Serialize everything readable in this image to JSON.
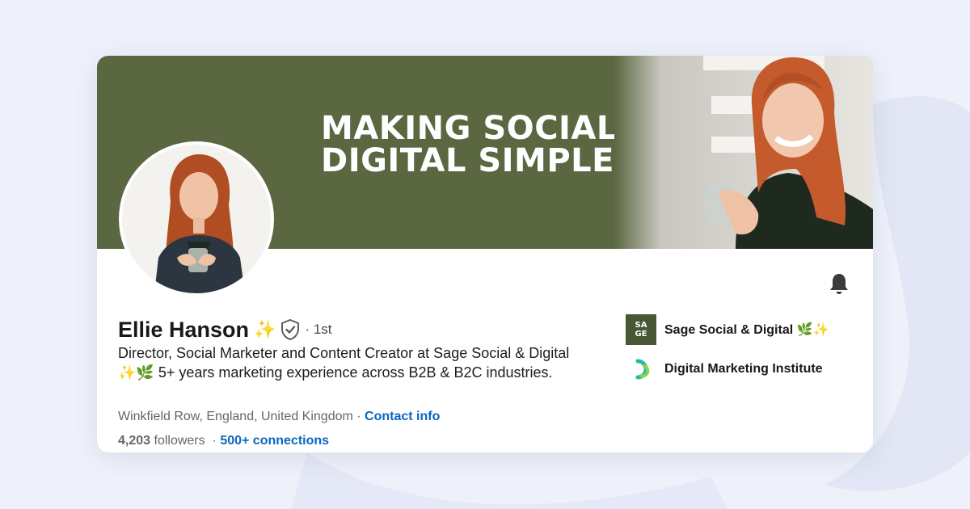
{
  "banner": {
    "headline_line1": "MAKING SOCIAL &",
    "headline_line2": "DIGITAL SIMPLE."
  },
  "profile": {
    "name": "Ellie Hanson",
    "name_emoji": "✨",
    "degree": "· 1st",
    "headline": "Director, Social Marketer and Content Creator at Sage Social & Digital ✨🌿 5+ years marketing experience across B2B & B2C industries.",
    "location": "Winkfield Row, England, United Kingdom",
    "location_separator": " · ",
    "contact_info_label": "Contact info",
    "followers_count": "4,203",
    "followers_label": "followers",
    "stats_separator": "· ",
    "connections_label": "500+ connections"
  },
  "companies": [
    {
      "name": "Sage Social & Digital 🌿✨",
      "logo_text": [
        "SA",
        "GE"
      ],
      "icon": "sage-logo"
    },
    {
      "name": "Digital Marketing Institute",
      "icon": "dmi-logo"
    }
  ],
  "icons": {
    "notification": "bell-icon",
    "verified": "verified-shield-icon"
  },
  "colors": {
    "banner": "#5a6740",
    "link": "#0a66c2",
    "page_background": "#eef1fa",
    "sage_logo": "#4a5735"
  }
}
